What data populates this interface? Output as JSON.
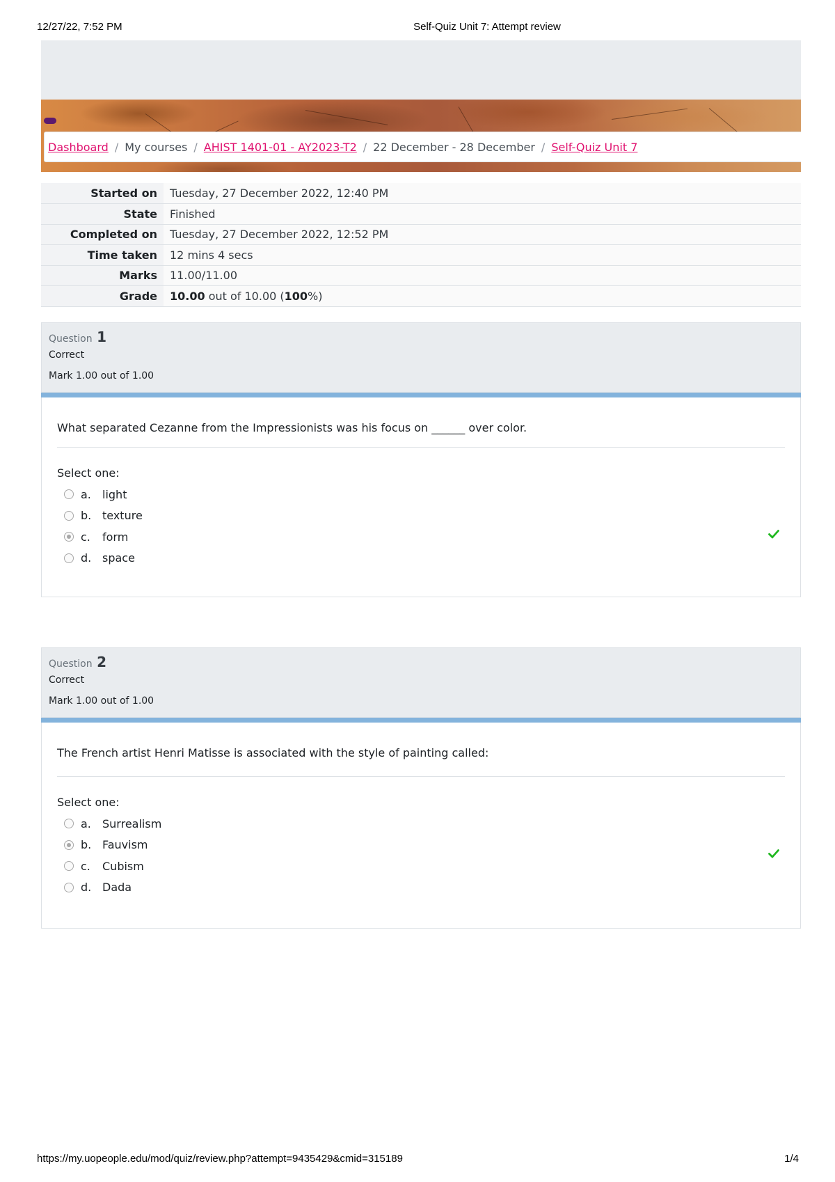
{
  "print_header": {
    "datetime": "12/27/22, 7:52 PM",
    "title": "Self-Quiz Unit 7: Attempt review"
  },
  "breadcrumb": {
    "dashboard": "Dashboard",
    "my_courses": "My courses",
    "course": "AHIST 1401-01 - AY2023-T2",
    "week": "22 December - 28 December",
    "quiz": "Self-Quiz Unit 7",
    "separator": "/"
  },
  "summary": {
    "started_on_label": "Started on",
    "started_on": "Tuesday, 27 December 2022, 12:40 PM",
    "state_label": "State",
    "state": "Finished",
    "completed_on_label": "Completed on",
    "completed_on": "Tuesday, 27 December 2022, 12:52 PM",
    "time_taken_label": "Time taken",
    "time_taken": "12 mins 4 secs",
    "marks_label": "Marks",
    "marks": "11.00/11.00",
    "grade_label": "Grade",
    "grade_value": "10.00",
    "grade_out_of": " out of 10.00 (",
    "grade_percent": "100",
    "grade_suffix": "%)"
  },
  "questions": [
    {
      "label": "Question",
      "number": "1",
      "state": "Correct",
      "mark": "Mark 1.00 out of 1.00",
      "text": "What separated Cezanne from the Impressionists was his focus on ______ over color.",
      "prompt": "Select one:",
      "answers": [
        {
          "letter": "a.",
          "text": "light",
          "selected": false
        },
        {
          "letter": "b.",
          "text": "texture",
          "selected": false
        },
        {
          "letter": "c.",
          "text": "form",
          "selected": true
        },
        {
          "letter": "d.",
          "text": "space",
          "selected": false
        }
      ],
      "correct_icon": "check-icon",
      "correct_color": "#1fb81f"
    },
    {
      "label": "Question",
      "number": "2",
      "state": "Correct",
      "mark": "Mark 1.00 out of 1.00",
      "text": "The French artist Henri Matisse is associated with the style of painting called:",
      "prompt": "Select one:",
      "answers": [
        {
          "letter": "a.",
          "text": "Surrealism",
          "selected": false
        },
        {
          "letter": "b.",
          "text": "Fauvism",
          "selected": true
        },
        {
          "letter": "c.",
          "text": "Cubism",
          "selected": false
        },
        {
          "letter": "d.",
          "text": "Dada",
          "selected": false
        }
      ],
      "correct_icon": "check-icon",
      "correct_color": "#1fb81f"
    }
  ],
  "print_footer": {
    "url": "https://my.uopeople.edu/mod/quiz/review.php?attempt=9435429&cmid=315189",
    "page": "1/4"
  },
  "colors": {
    "link": "#e0116f",
    "question_bar": "#83b3dc",
    "brand_pill": "#5c1a6e"
  }
}
